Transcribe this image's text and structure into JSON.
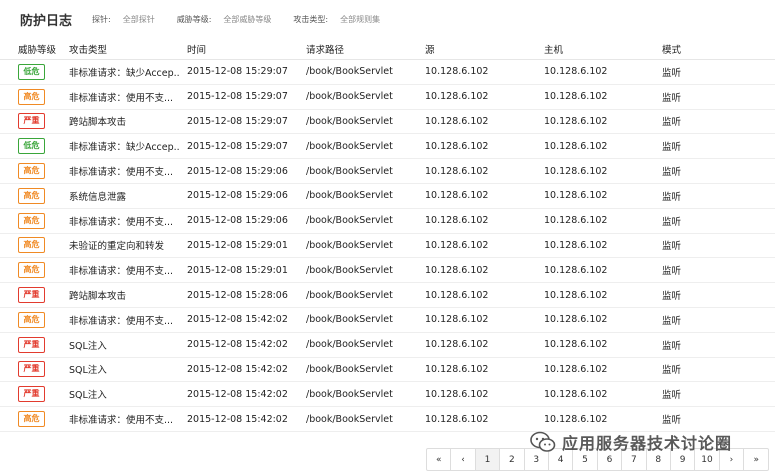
{
  "header": {
    "title": "防护日志",
    "filters": [
      {
        "label": "探针:",
        "value": "全部探针"
      },
      {
        "label": "威胁等级:",
        "value": "全部威胁等级"
      },
      {
        "label": "攻击类型:",
        "value": "全部规则集"
      }
    ]
  },
  "table": {
    "columns": [
      "威胁等级",
      "攻击类型",
      "时间",
      "请求路径",
      "源",
      "主机",
      "模式"
    ],
    "rows": [
      {
        "level": "低危",
        "level_color": "#3aa63a",
        "type": "非标准请求：缺少Accep...",
        "time": "2015-12-08 15:29:07",
        "path": "/book/BookServlet",
        "src": "10.128.6.102",
        "host": "10.128.6.102",
        "mode": "监听"
      },
      {
        "level": "高危",
        "level_color": "#f08a24",
        "type": "非标准请求：使用不支...",
        "time": "2015-12-08 15:29:07",
        "path": "/book/BookServlet",
        "src": "10.128.6.102",
        "host": "10.128.6.102",
        "mode": "监听"
      },
      {
        "level": "严重",
        "level_color": "#e23b2e",
        "type": "跨站脚本攻击",
        "time": "2015-12-08 15:29:07",
        "path": "/book/BookServlet",
        "src": "10.128.6.102",
        "host": "10.128.6.102",
        "mode": "监听"
      },
      {
        "level": "低危",
        "level_color": "#3aa63a",
        "type": "非标准请求：缺少Accep...",
        "time": "2015-12-08 15:29:07",
        "path": "/book/BookServlet",
        "src": "10.128.6.102",
        "host": "10.128.6.102",
        "mode": "监听"
      },
      {
        "level": "高危",
        "level_color": "#f08a24",
        "type": "非标准请求：使用不支...",
        "time": "2015-12-08 15:29:06",
        "path": "/book/BookServlet",
        "src": "10.128.6.102",
        "host": "10.128.6.102",
        "mode": "监听"
      },
      {
        "level": "高危",
        "level_color": "#f08a24",
        "type": "系统信息泄露",
        "time": "2015-12-08 15:29:06",
        "path": "/book/BookServlet",
        "src": "10.128.6.102",
        "host": "10.128.6.102",
        "mode": "监听"
      },
      {
        "level": "高危",
        "level_color": "#f08a24",
        "type": "非标准请求：使用不支...",
        "time": "2015-12-08 15:29:06",
        "path": "/book/BookServlet",
        "src": "10.128.6.102",
        "host": "10.128.6.102",
        "mode": "监听"
      },
      {
        "level": "高危",
        "level_color": "#f08a24",
        "type": "未验证的重定向和转发",
        "time": "2015-12-08 15:29:01",
        "path": "/book/BookServlet",
        "src": "10.128.6.102",
        "host": "10.128.6.102",
        "mode": "监听"
      },
      {
        "level": "高危",
        "level_color": "#f08a24",
        "type": "非标准请求：使用不支...",
        "time": "2015-12-08 15:29:01",
        "path": "/book/BookServlet",
        "src": "10.128.6.102",
        "host": "10.128.6.102",
        "mode": "监听"
      },
      {
        "level": "严重",
        "level_color": "#e23b2e",
        "type": "跨站脚本攻击",
        "time": "2015-12-08 15:28:06",
        "path": "/book/BookServlet",
        "src": "10.128.6.102",
        "host": "10.128.6.102",
        "mode": "监听"
      },
      {
        "level": "高危",
        "level_color": "#f08a24",
        "type": "非标准请求：使用不支...",
        "time": "2015-12-08 15:42:02",
        "path": "/book/BookServlet",
        "src": "10.128.6.102",
        "host": "10.128.6.102",
        "mode": "监听"
      },
      {
        "level": "严重",
        "level_color": "#e23b2e",
        "type": "SQL注入",
        "time": "2015-12-08 15:42:02",
        "path": "/book/BookServlet",
        "src": "10.128.6.102",
        "host": "10.128.6.102",
        "mode": "监听"
      },
      {
        "level": "严重",
        "level_color": "#e23b2e",
        "type": "SQL注入",
        "time": "2015-12-08 15:42:02",
        "path": "/book/BookServlet",
        "src": "10.128.6.102",
        "host": "10.128.6.102",
        "mode": "监听"
      },
      {
        "level": "严重",
        "level_color": "#e23b2e",
        "type": "SQL注入",
        "time": "2015-12-08 15:42:02",
        "path": "/book/BookServlet",
        "src": "10.128.6.102",
        "host": "10.128.6.102",
        "mode": "监听"
      },
      {
        "level": "高危",
        "level_color": "#f08a24",
        "type": "非标准请求：使用不支...",
        "time": "2015-12-08 15:42:02",
        "path": "/book/BookServlet",
        "src": "10.128.6.102",
        "host": "10.128.6.102",
        "mode": "监听"
      }
    ]
  },
  "pagination": {
    "first": "«",
    "prev": "‹",
    "pages": [
      "1",
      "2",
      "3",
      "4",
      "5",
      "6",
      "7",
      "8",
      "9",
      "10"
    ],
    "current": "1",
    "next": "›",
    "last": "»"
  },
  "watermark": {
    "icon": "wechat-icon",
    "text": "应用服务器技术讨论圈"
  }
}
